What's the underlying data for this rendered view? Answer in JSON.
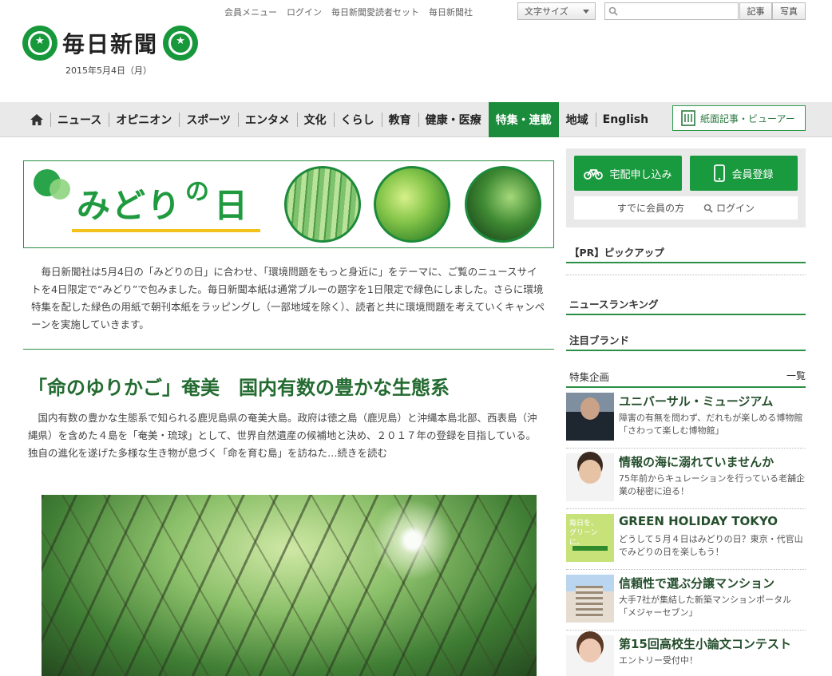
{
  "header": {
    "top_links": [
      "会員メニュー",
      "ログイン",
      "毎日新聞愛読者セット",
      "毎日新聞社"
    ],
    "font_size_label": "文字サイズ",
    "search": {
      "placeholder": "",
      "btn_articles": "記事",
      "btn_photos": "写真"
    },
    "logo_text": "毎日新聞",
    "date": "2015年5月4日（月）"
  },
  "nav": {
    "items": [
      "ニュース",
      "オピニオン",
      "スポーツ",
      "エンタメ",
      "文化",
      "くらし",
      "教育",
      "健康・医療",
      "特集・連載",
      "地域",
      "English"
    ],
    "active_index": 8,
    "viewer_label": "紙面記事・ビューアー"
  },
  "banner": {
    "title_main": "みどり",
    "title_no": "の",
    "title_end": "日"
  },
  "intro": "毎日新聞社は5月4日の「みどりの日」に合わせ、「環境問題をもっと身近に」をテーマに、ご覧のニュースサイトを4日限定で“みどり”で包みました。毎日新聞本紙は通常ブルーの題字を1日限定で緑色にしました。さらに環境特集を配した緑色の用紙で朝刊本紙をラッピングし（一部地域を除く）、読者と共に環境問題を考えていくキャンペーンを実施していきます。",
  "article": {
    "headline": "「命のゆりかご」奄美　国内有数の豊かな生態系",
    "lead": "国内有数の豊かな生態系で知られる鹿児島県の奄美大島。政府は徳之島（鹿児島）と沖縄本島北部、西表島（沖縄県）を含めた４島を「奄美・琉球」として、世界自然遺産の候補地と決め、２０１７年の登録を目指している。独自の進化を遂げた多様な生き物が息づく「命を育む島」を訪ねた…",
    "more": "続きを読む"
  },
  "sidebar": {
    "delivery_btn": "宅配申し込み",
    "register_btn": "会員登録",
    "already_member": "すでに会員の方",
    "login": "ログイン",
    "pr_pickup": "【PR】ピックアップ",
    "news_ranking": "ニュースランキング",
    "featured_brand": "注目ブランド",
    "special_title": "特集企画",
    "list_link": "一覧",
    "features": [
      {
        "title": "ユニバーサル・ミュージアム",
        "desc": "障害の有無を問わず、だれもが楽しめる博物館「さわって楽しむ博物館」"
      },
      {
        "title": "情報の海に溺れていませんか",
        "desc": "75年前からキュレーションを行っている老舗企業の秘密に迫る！"
      },
      {
        "title": "GREEN HOLIDAY TOKYO",
        "desc": "どうして５月４日はみどりの日？東京・代官山でみどりの日を楽しもう！",
        "thumb_text": "毎日を、グリーンに。"
      },
      {
        "title": "信頼性で選ぶ分譲マンション",
        "desc": "大手7社が集結した新築マンションポータル「メジャーセブン」"
      },
      {
        "title": "第15回高校生小論文コンテスト",
        "desc": "エントリー受付中！"
      }
    ]
  }
}
